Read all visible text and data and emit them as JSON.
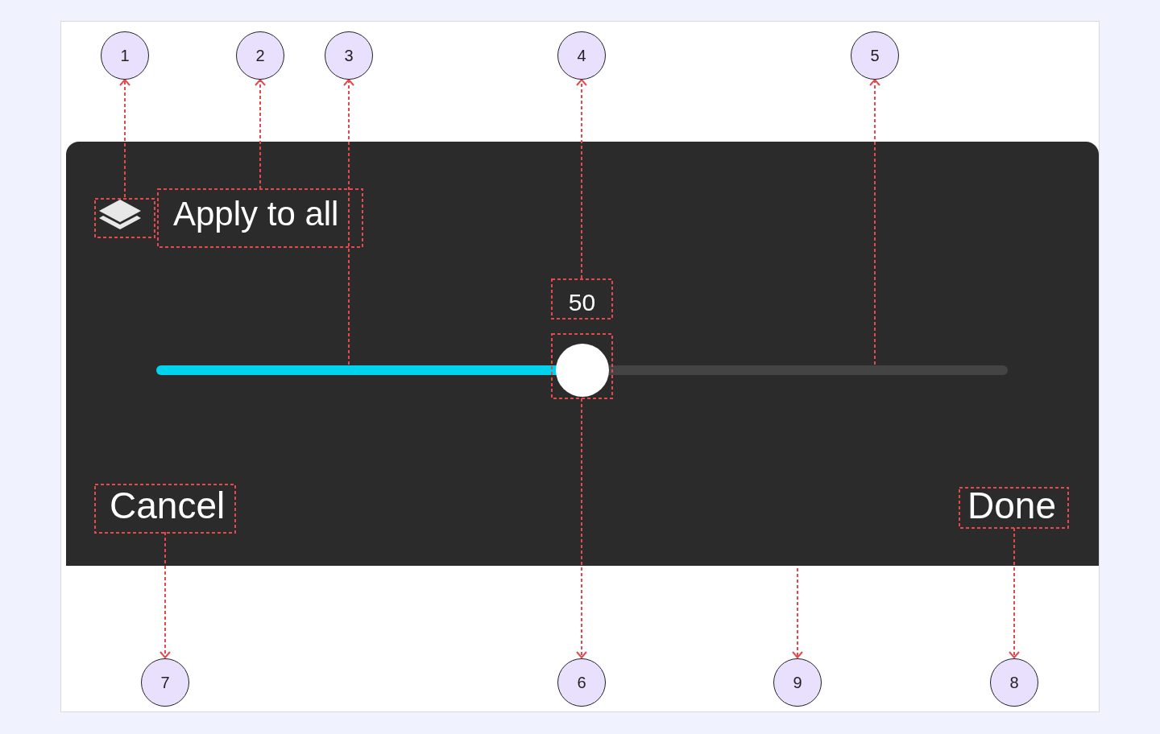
{
  "dialog": {
    "title": "Apply to all",
    "value": "50",
    "level": 0.5,
    "cancel": "Cancel",
    "done": "Done"
  },
  "callouts": [
    {
      "number": "1"
    },
    {
      "number": "2"
    },
    {
      "number": "3"
    },
    {
      "number": "4"
    },
    {
      "number": "5"
    },
    {
      "number": "7"
    },
    {
      "number": "6"
    },
    {
      "number": "9"
    },
    {
      "number": "8"
    }
  ]
}
